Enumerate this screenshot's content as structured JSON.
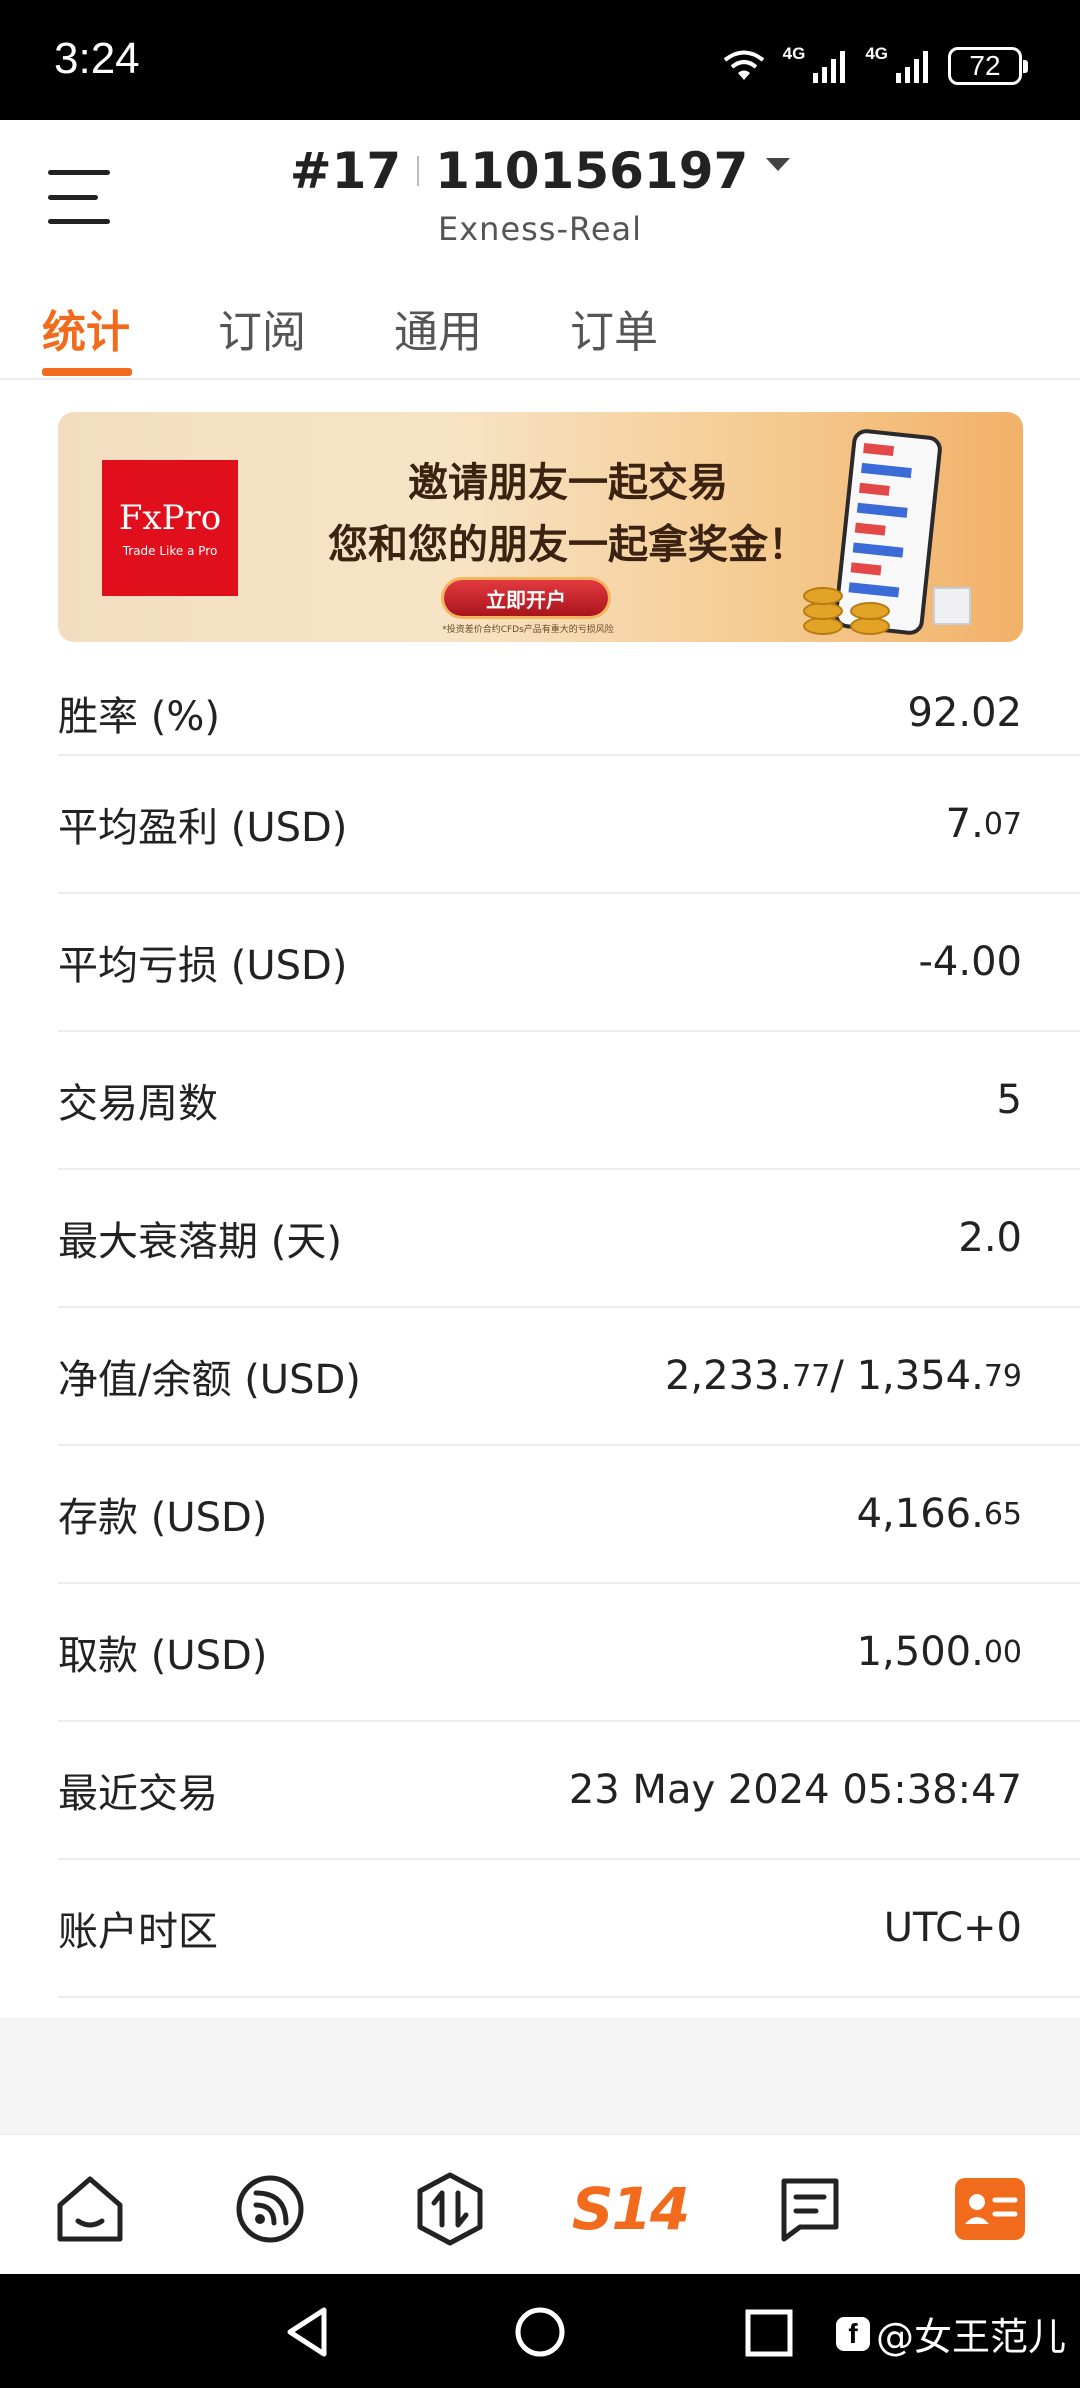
{
  "status_bar": {
    "time": "3:24",
    "network_1": "4G",
    "network_2": "4G",
    "battery": "72"
  },
  "header": {
    "account_number": "#17",
    "account_id": "110156197",
    "server": "Exness-Real"
  },
  "tabs": [
    {
      "label": "统计",
      "active": true
    },
    {
      "label": "订阅",
      "active": false
    },
    {
      "label": "通用",
      "active": false
    },
    {
      "label": "订单",
      "active": false
    }
  ],
  "banner": {
    "logo_text": "FxPro",
    "logo_tagline": "Trade Like a Pro",
    "headline_1": "邀请朋友一起交易",
    "headline_2": "您和您的朋友一起拿奖金！",
    "cta": "立即开户",
    "disclaimer": "*投资差价合约CFDs产品有重大的亏损风险"
  },
  "stats": [
    {
      "label": "胜率 (%)",
      "value": "92.02",
      "decimals": ""
    },
    {
      "label": "平均盈利 (USD)",
      "value": "7.",
      "decimals": "07"
    },
    {
      "label": "平均亏损 (USD)",
      "value": "-4.00",
      "decimals": ""
    },
    {
      "label": "交易周数",
      "value": "5",
      "decimals": ""
    },
    {
      "label": "最大衰落期 (天)",
      "value": "2.0",
      "decimals": ""
    },
    {
      "label": "净值/余额 (USD)",
      "value": "2,233.",
      "decimals": "77",
      "value_b": " / 1,354.",
      "decimals_b": "79"
    },
    {
      "label": "存款 (USD)",
      "value": "4,166.",
      "decimals": "65"
    },
    {
      "label": "取款 (USD)",
      "value": "1,500.",
      "decimals": "00"
    },
    {
      "label": "最近交易",
      "value": "23 May 2024 05:38:47",
      "decimals": ""
    },
    {
      "label": "账户时区",
      "value": "UTC+0",
      "decimals": ""
    }
  ],
  "bottom_nav": {
    "items": [
      "home-icon",
      "feed-icon",
      "trade-icon",
      "s14-logo",
      "message-icon",
      "profile-icon"
    ],
    "logo_text": "S14",
    "active": "profile-icon",
    "accent": "#f26b1d"
  },
  "watermark": "@女王范儿"
}
